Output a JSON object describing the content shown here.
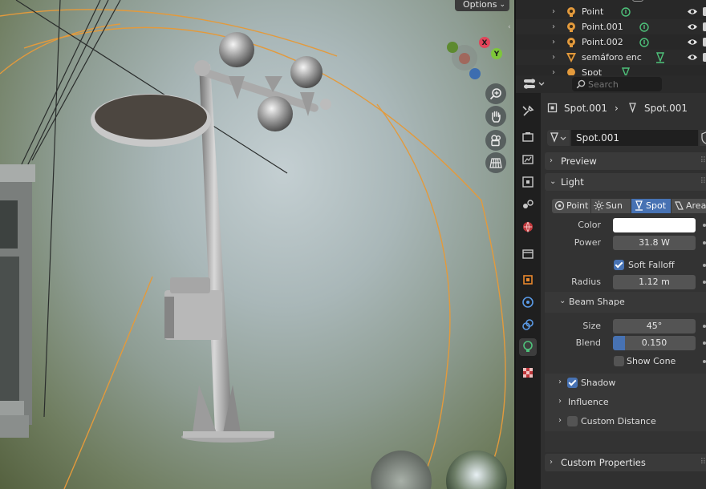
{
  "viewport": {
    "options_label": "Options",
    "gizmo": {
      "x_label": "X",
      "y_label": "Y"
    },
    "colors": {
      "orange_outline": "#e39a3c",
      "sky_top": "#c4cfd2",
      "ground": "#55613f"
    }
  },
  "outliner": {
    "rows": [
      {
        "name": "Point",
        "icon": "point-light-icon"
      },
      {
        "name": "Point.001",
        "icon": "point-light-icon"
      },
      {
        "name": "Point.002",
        "icon": "point-light-icon"
      },
      {
        "name": "semáforo enc",
        "icon": "cone-light-icon"
      },
      {
        "name": "Spot",
        "icon": "spot-light-icon"
      }
    ]
  },
  "properties": {
    "search_placeholder": "Search",
    "breadcrumb": {
      "object": "Spot.001",
      "data": "Spot.001"
    },
    "datablock_name": "Spot.001",
    "panels": {
      "preview": "Preview",
      "light": "Light",
      "shadow": "Shadow",
      "influence": "Influence",
      "custom_distance": "Custom Distance",
      "custom_properties": "Custom Properties"
    },
    "light_types": [
      "Point",
      "Sun",
      "Spot",
      "Area"
    ],
    "active_light_type": "Spot",
    "color_label": "Color",
    "color_value": "#ffffff",
    "power_label": "Power",
    "power_value": "31.8 W",
    "soft_falloff_label": "Soft Falloff",
    "soft_falloff": true,
    "radius_label": "Radius",
    "radius_value": "1.12 m",
    "beam_shape_label": "Beam Shape",
    "size_label": "Size",
    "size_value": "45°",
    "blend_label": "Blend",
    "blend_value": "0.150",
    "blend_fraction": 0.15,
    "show_cone_label": "Show Cone",
    "show_cone": false,
    "shadow_enabled": true,
    "custom_distance_enabled": false,
    "accent_color": "#4772b3"
  }
}
